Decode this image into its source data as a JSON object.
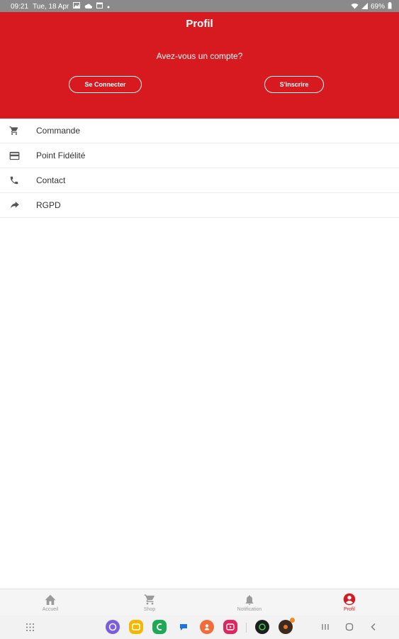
{
  "status_bar": {
    "time": "09:21",
    "date": "Tue, 18 Apr",
    "battery": "69%"
  },
  "header": {
    "title": "Profil",
    "question": "Avez-vous un compte?",
    "login_label": "Se Connecter",
    "register_label": "S'inscrire"
  },
  "menu": {
    "items": [
      {
        "label": "Commande",
        "icon": "cart-icon"
      },
      {
        "label": "Point Fidélité",
        "icon": "card-icon"
      },
      {
        "label": "Contact",
        "icon": "phone-icon"
      },
      {
        "label": "RGPD",
        "icon": "share-icon"
      }
    ]
  },
  "bottom_nav": {
    "items": [
      {
        "label": "Accueil",
        "icon": "home-icon"
      },
      {
        "label": "Shop",
        "icon": "cart-icon"
      },
      {
        "label": "Notification",
        "icon": "bell-icon"
      },
      {
        "label": "Profil",
        "icon": "profile-icon",
        "active": true
      }
    ]
  },
  "colors": {
    "accent": "#d71a20",
    "status_bar": "#8a8a8a",
    "icon": "#555555",
    "nav_inactive": "#9a9a9a"
  }
}
